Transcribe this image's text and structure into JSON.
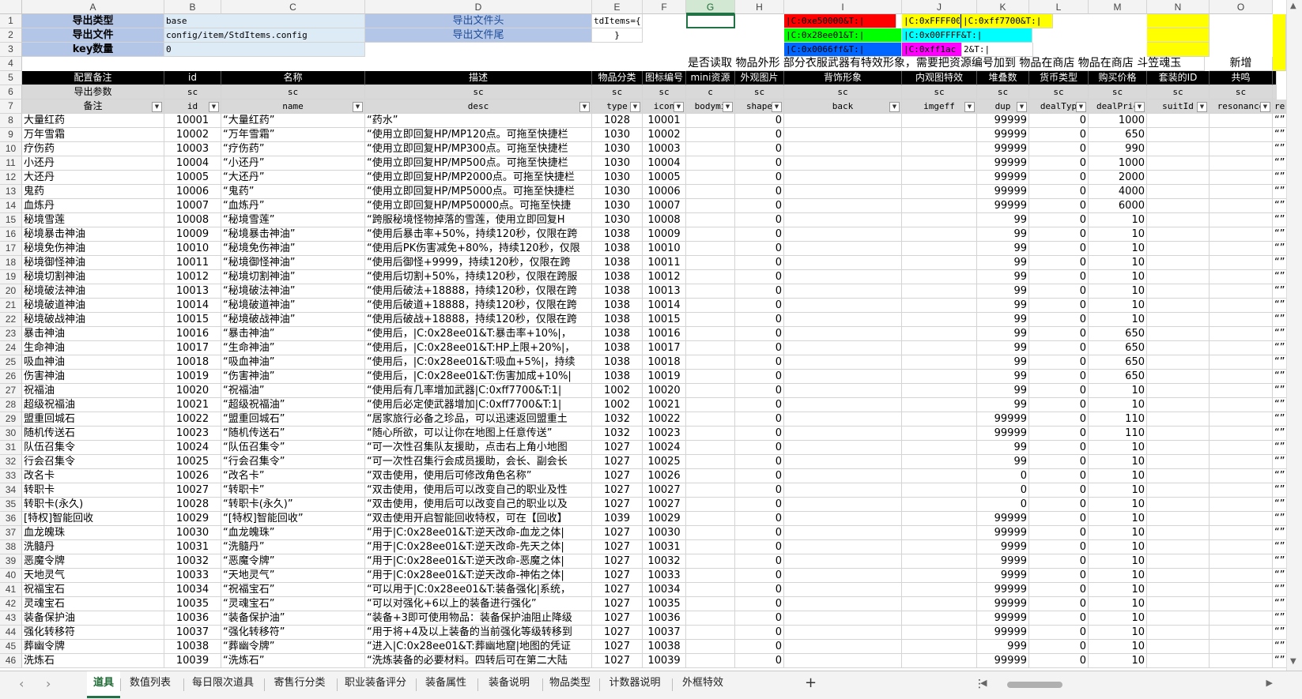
{
  "columns": [
    "A",
    "B",
    "C",
    "D",
    "E",
    "F",
    "G",
    "H",
    "I",
    "J",
    "K",
    "L",
    "M",
    "N",
    "O"
  ],
  "row_numbers": [
    "1",
    "2",
    "3",
    "4",
    "5",
    "6",
    "7",
    "8",
    "9",
    "10",
    "11",
    "12",
    "13",
    "14",
    "15",
    "16",
    "17",
    "18",
    "19",
    "20",
    "21",
    "22",
    "23",
    "24",
    "25",
    "26",
    "27",
    "28",
    "29",
    "30",
    "31",
    "32",
    "33",
    "34",
    "35",
    "36",
    "37",
    "38",
    "39",
    "40",
    "41",
    "42",
    "43",
    "44",
    "45",
    "46"
  ],
  "meta": {
    "r1": {
      "a": "导出类型",
      "b": "base",
      "d": "导出文件头",
      "e": "tdItems={"
    },
    "r2": {
      "a": "导出文件",
      "b": "config/item/StdItems.config",
      "d": "导出文件尾",
      "e": "}"
    },
    "r3": {
      "a": "key数量",
      "b": "0"
    },
    "r4_note": "是否读取 物品外形 部分衣服武器有特效形象，需要把资源编号加到 物品在商店 物品在商店 斗笠魂玉",
    "r4_new": "新增",
    "color_codes": {
      "red": "|C:0xe50000&T:|",
      "yellow": "|C:0xFFFF00",
      "orange": "|C:0xff7700&T:|",
      "green": "|C:0x28ee01&T:|",
      "cyan": "|C:0x00FFFF&T:|",
      "blue": "|C:0x0066ff&T:|",
      "magenta": "|C:0xff1ac",
      "magenta_tail": "2&T:|"
    }
  },
  "headers": {
    "r5": [
      "配置备注",
      "id",
      "名称",
      "描述",
      "物品分类",
      "图标编号",
      "mini资源",
      "外观图片",
      "背饰形象",
      "内观图特效",
      "堆叠数",
      "货币类型",
      "购买价格",
      "套装的ID",
      "共鸣"
    ],
    "r6": [
      "导出参数",
      "sc",
      "sc",
      "sc",
      "sc",
      "sc",
      "c",
      "sc",
      "sc",
      "sc",
      "sc",
      "sc",
      "sc",
      "sc",
      "sc"
    ],
    "r7": [
      "备注",
      "id",
      "name",
      "desc",
      "type",
      "icon",
      "bodymi",
      "shape",
      "back",
      "imgeff",
      "dup",
      "dealTyp",
      "dealPric",
      "suitId",
      "resonance"
    ]
  },
  "rows": [
    [
      "大量红药",
      "10001",
      "“大量红药”",
      "“药水”",
      "1028",
      "10001",
      "",
      "0",
      "",
      "",
      "99999",
      "0",
      "1000",
      "",
      ""
    ],
    [
      "万年雪霜",
      "10002",
      "“万年雪霜”",
      "“使用立即回复HP/MP120点。可拖至快捷栏",
      "1030",
      "10002",
      "",
      "0",
      "",
      "",
      "99999",
      "0",
      "650",
      "",
      ""
    ],
    [
      "疗伤药",
      "10003",
      "“疗伤药”",
      "“使用立即回复HP/MP300点。可拖至快捷栏",
      "1030",
      "10003",
      "",
      "0",
      "",
      "",
      "99999",
      "0",
      "990",
      "",
      ""
    ],
    [
      "小还丹",
      "10004",
      "“小还丹”",
      "“使用立即回复HP/MP500点。可拖至快捷栏",
      "1030",
      "10004",
      "",
      "0",
      "",
      "",
      "99999",
      "0",
      "1000",
      "",
      ""
    ],
    [
      "大还丹",
      "10005",
      "“大还丹”",
      "“使用立即回复HP/MP2000点。可拖至快捷栏",
      "1030",
      "10005",
      "",
      "0",
      "",
      "",
      "99999",
      "0",
      "2000",
      "",
      ""
    ],
    [
      "鬼药",
      "10006",
      "“鬼药”",
      "“使用立即回复HP/MP5000点。可拖至快捷栏",
      "1030",
      "10006",
      "",
      "0",
      "",
      "",
      "99999",
      "0",
      "4000",
      "",
      ""
    ],
    [
      "血炼丹",
      "10007",
      "“血炼丹”",
      "“使用立即回复HP/MP50000点。可拖至快捷",
      "1030",
      "10007",
      "",
      "0",
      "",
      "",
      "99999",
      "0",
      "6000",
      "",
      ""
    ],
    [
      "秘境雪莲",
      "10008",
      "“秘境雪莲”",
      "“跨服秘境怪物掉落的雪莲，使用立即回复H",
      "1030",
      "10008",
      "",
      "0",
      "",
      "",
      "99",
      "0",
      "10",
      "",
      ""
    ],
    [
      "秘境暴击神油",
      "10009",
      "“秘境暴击神油”",
      "“使用后暴击率+50%，持续120秒，仅限在跨",
      "1038",
      "10009",
      "",
      "0",
      "",
      "",
      "99",
      "0",
      "10",
      "",
      ""
    ],
    [
      "秘境免伤神油",
      "10010",
      "“秘境免伤神油”",
      "“使用后PK伤害减免+80%，持续120秒，仅限",
      "1038",
      "10010",
      "",
      "0",
      "",
      "",
      "99",
      "0",
      "10",
      "",
      ""
    ],
    [
      "秘境御怪神油",
      "10011",
      "“秘境御怪神油”",
      "“使用后御怪+9999，持续120秒，仅限在跨",
      "1038",
      "10011",
      "",
      "0",
      "",
      "",
      "99",
      "0",
      "10",
      "",
      ""
    ],
    [
      "秘境切割神油",
      "10012",
      "“秘境切割神油”",
      "“使用后切割+50%，持续120秒，仅限在跨服",
      "1038",
      "10012",
      "",
      "0",
      "",
      "",
      "99",
      "0",
      "10",
      "",
      ""
    ],
    [
      "秘境破法神油",
      "10013",
      "“秘境破法神油”",
      "“使用后破法+18888，持续120秒，仅限在跨",
      "1038",
      "10013",
      "",
      "0",
      "",
      "",
      "99",
      "0",
      "10",
      "",
      ""
    ],
    [
      "秘境破道神油",
      "10014",
      "“秘境破道神油”",
      "“使用后破道+18888，持续120秒，仅限在跨",
      "1038",
      "10014",
      "",
      "0",
      "",
      "",
      "99",
      "0",
      "10",
      "",
      ""
    ],
    [
      "秘境破战神油",
      "10015",
      "“秘境破战神油”",
      "“使用后破战+18888，持续120秒，仅限在跨",
      "1038",
      "10015",
      "",
      "0",
      "",
      "",
      "99",
      "0",
      "10",
      "",
      ""
    ],
    [
      "暴击神油",
      "10016",
      "“暴击神油”",
      "“使用后，|C:0x28ee01&T:暴击率+10%|，",
      "1038",
      "10016",
      "",
      "0",
      "",
      "",
      "99",
      "0",
      "650",
      "",
      ""
    ],
    [
      "生命神油",
      "10017",
      "“生命神油”",
      "“使用后，|C:0x28ee01&T:HP上限+20%|，",
      "1038",
      "10017",
      "",
      "0",
      "",
      "",
      "99",
      "0",
      "650",
      "",
      ""
    ],
    [
      "吸血神油",
      "10018",
      "“吸血神油”",
      "“使用后，|C:0x28ee01&T:吸血+5%|，持续",
      "1038",
      "10018",
      "",
      "0",
      "",
      "",
      "99",
      "0",
      "650",
      "",
      ""
    ],
    [
      "伤害神油",
      "10019",
      "“伤害神油”",
      "“使用后，|C:0x28ee01&T:伤害加成+10%|",
      "1038",
      "10019",
      "",
      "0",
      "",
      "",
      "99",
      "0",
      "650",
      "",
      ""
    ],
    [
      "祝福油",
      "10020",
      "“祝福油”",
      "“使用后有几率增加武器|C:0xff7700&T:1|",
      "1002",
      "10020",
      "",
      "0",
      "",
      "",
      "99",
      "0",
      "10",
      "",
      ""
    ],
    [
      "超级祝福油",
      "10021",
      "“超级祝福油”",
      "“使用后必定使武器增加|C:0xff7700&T:1|",
      "1002",
      "10021",
      "",
      "0",
      "",
      "",
      "99",
      "0",
      "10",
      "",
      ""
    ],
    [
      "盟重回城石",
      "10022",
      "“盟重回城石”",
      "“居家旅行必备之珍品，可以迅速返回盟重土",
      "1032",
      "10022",
      "",
      "0",
      "",
      "",
      "99999",
      "0",
      "110",
      "",
      ""
    ],
    [
      "随机传送石",
      "10023",
      "“随机传送石”",
      "“随心所欲，可以让你在地图上任意传送”",
      "1032",
      "10023",
      "",
      "0",
      "",
      "",
      "99999",
      "0",
      "110",
      "",
      ""
    ],
    [
      "队伍召集令",
      "10024",
      "“队伍召集令”",
      "“可一次性召集队友援助，点击右上角小地图",
      "1027",
      "10024",
      "",
      "0",
      "",
      "",
      "99",
      "0",
      "10",
      "",
      ""
    ],
    [
      "行会召集令",
      "10025",
      "“行会召集令”",
      "“可一次性召集行会成员援助，会长、副会长",
      "1027",
      "10025",
      "",
      "0",
      "",
      "",
      "99",
      "0",
      "10",
      "",
      ""
    ],
    [
      "改名卡",
      "10026",
      "“改名卡”",
      "“双击使用，使用后可修改角色名称”",
      "1027",
      "10026",
      "",
      "0",
      "",
      "",
      "0",
      "0",
      "10",
      "",
      ""
    ],
    [
      "转职卡",
      "10027",
      "“转职卡”",
      "“双击使用，使用后可以改变自己的职业及性",
      "1027",
      "10027",
      "",
      "0",
      "",
      "",
      "0",
      "0",
      "10",
      "",
      ""
    ],
    [
      "转职卡(永久)",
      "10028",
      "“转职卡(永久)”",
      "“双击使用，使用后可以改变自己的职业以及",
      "1027",
      "10027",
      "",
      "0",
      "",
      "",
      "0",
      "0",
      "10",
      "",
      ""
    ],
    [
      "[特权]智能回收",
      "10029",
      "“[特权]智能回收”",
      "“双击使用开启智能回收特权，可在【回收】",
      "1039",
      "10029",
      "",
      "0",
      "",
      "",
      "99999",
      "0",
      "10",
      "",
      ""
    ],
    [
      "血龙魄珠",
      "10030",
      "“血龙魄珠”",
      "“用于|C:0x28ee01&T:逆天改命-血龙之体|",
      "1027",
      "10030",
      "",
      "0",
      "",
      "",
      "99999",
      "0",
      "10",
      "",
      ""
    ],
    [
      "洗髓丹",
      "10031",
      "“洗髓丹”",
      "“用于|C:0x28ee01&T:逆天改命-先天之体|",
      "1027",
      "10031",
      "",
      "0",
      "",
      "",
      "9999",
      "0",
      "10",
      "",
      ""
    ],
    [
      "恶魔令牌",
      "10032",
      "“恶魔令牌”",
      "“用于|C:0x28ee01&T:逆天改命-恶魔之体|",
      "1027",
      "10032",
      "",
      "0",
      "",
      "",
      "9999",
      "0",
      "10",
      "",
      ""
    ],
    [
      "天地灵气",
      "10033",
      "“天地灵气”",
      "“用于|C:0x28ee01&T:逆天改命-神佑之体|",
      "1027",
      "10033",
      "",
      "0",
      "",
      "",
      "9999",
      "0",
      "10",
      "",
      ""
    ],
    [
      "祝福宝石",
      "10034",
      "“祝福宝石”",
      "“可以用于|C:0x28ee01&T:装备强化|系统，",
      "1027",
      "10034",
      "",
      "0",
      "",
      "",
      "99999",
      "0",
      "10",
      "",
      ""
    ],
    [
      "灵魂宝石",
      "10035",
      "“灵魂宝石”",
      "“可以对强化+6以上的装备进行强化”",
      "1027",
      "10035",
      "",
      "0",
      "",
      "",
      "99999",
      "0",
      "10",
      "",
      ""
    ],
    [
      "装备保护油",
      "10036",
      "“装备保护油”",
      "“装备+3即可使用物品：装备保护油阻止降级",
      "1027",
      "10036",
      "",
      "0",
      "",
      "",
      "99999",
      "0",
      "10",
      "",
      ""
    ],
    [
      "强化转移符",
      "10037",
      "“强化转移符”",
      "“用于将+4及以上装备的当前强化等级转移到",
      "1027",
      "10037",
      "",
      "0",
      "",
      "",
      "99999",
      "0",
      "10",
      "",
      ""
    ],
    [
      "葬幽令牌",
      "10038",
      "“葬幽令牌”",
      "“进入|C:0x28ee01&T:葬幽地窟|地图的凭证",
      "1027",
      "10038",
      "",
      "0",
      "",
      "",
      "999",
      "0",
      "10",
      "",
      ""
    ],
    [
      "洗炼石",
      "10039",
      "“洗炼石”",
      "“洗炼装备的必要材料。四转后可在第二大陆",
      "1027",
      "10039",
      "",
      "0",
      "",
      "",
      "99999",
      "0",
      "10",
      "",
      ""
    ]
  ],
  "tail_mark": "“”",
  "tabs": [
    "道具",
    "数值列表",
    "每日限次道具",
    "寄售行分类",
    "职业装备评分",
    "装备属性",
    "装备说明",
    "物品类型",
    "计数器说明",
    "外框特效"
  ],
  "tab_add": "+",
  "tab_more": "⋮",
  "colors": {
    "header_black": "#000000",
    "label_blue": "#b4c6e7",
    "label_blue_light": "#ddebf7",
    "red": "#ff0000",
    "yellow": "#ffff00",
    "orange_bg": "#ffff00",
    "green": "#00ff00",
    "cyan": "#00ffff",
    "blue": "#0066ff",
    "magenta": "#ff00ff",
    "grey_row": "#d9d9d9",
    "accent": "#217346"
  }
}
